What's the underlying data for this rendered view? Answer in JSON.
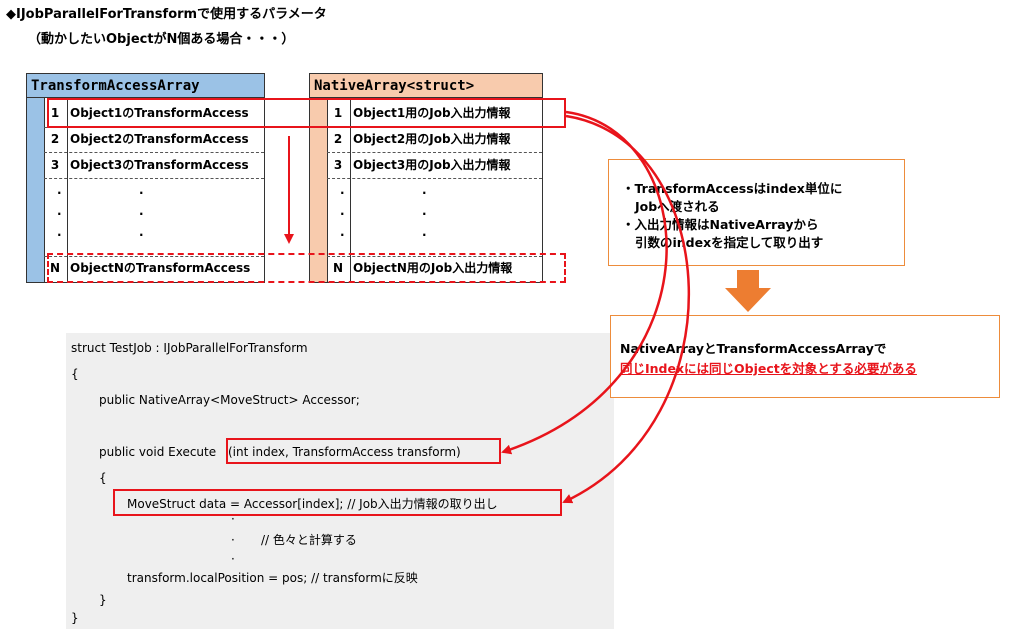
{
  "header": {
    "title": "◆IJobParallelForTransformで使用するパラメータ",
    "subtitle": "（動かしたいObjectがN個ある場合・・・）"
  },
  "left_table": {
    "header": "TransformAccessArray",
    "header_color": "#9bc2e6",
    "rows": [
      {
        "num": "1",
        "text": "Object1のTransformAccess"
      },
      {
        "num": "2",
        "text": "Object2のTransformAccess"
      },
      {
        "num": "3",
        "text": "Object3のTransformAccess"
      },
      {
        "num": "N",
        "text": "ObjectNのTransformAccess"
      }
    ],
    "ellipsis": "."
  },
  "right_table": {
    "header": "NativeArray<struct>",
    "header_color": "#f8cbad",
    "rows": [
      {
        "num": "1",
        "text": "Object1用のJob入出力情報"
      },
      {
        "num": "2",
        "text": "Object2用のJob入出力情報"
      },
      {
        "num": "3",
        "text": "Object3用のJob入出力情報"
      },
      {
        "num": "N",
        "text": "ObjectN用のJob入出力情報"
      }
    ],
    "ellipsis": "."
  },
  "info_box_1": {
    "line1": "・TransformAccessはindex単位に",
    "line2": "Jobへ渡される",
    "line3": "・入出力情報はNativeArrayから",
    "line4": "引数のindexを指定して取り出す"
  },
  "info_box_2": {
    "line1": "NativeArrayとTransformAccessArrayで",
    "line2": "同じIndexには同じObjectを対象とする必要がある"
  },
  "code": {
    "l1": "struct TestJob : IJobParallelForTransform",
    "l2": "{",
    "l3": "public NativeArray<MoveStruct> Accessor;",
    "l4a": "public void Execute",
    "l4b": "(int index, TransformAccess transform)",
    "l5": "{",
    "l6": "MoveStruct data = Accessor[index];  // Job入出力情報の取り出し",
    "dot": "·",
    "l7": "// 色々と計算する",
    "l8": "transform.localPosition = pos;  // transformに反映",
    "l9": "}",
    "l10": "}"
  },
  "colors": {
    "accent_red": "#e8141b",
    "accent_orange": "#ed7d31",
    "box_border": "#ed8c3b",
    "code_bg": "#efefef"
  }
}
